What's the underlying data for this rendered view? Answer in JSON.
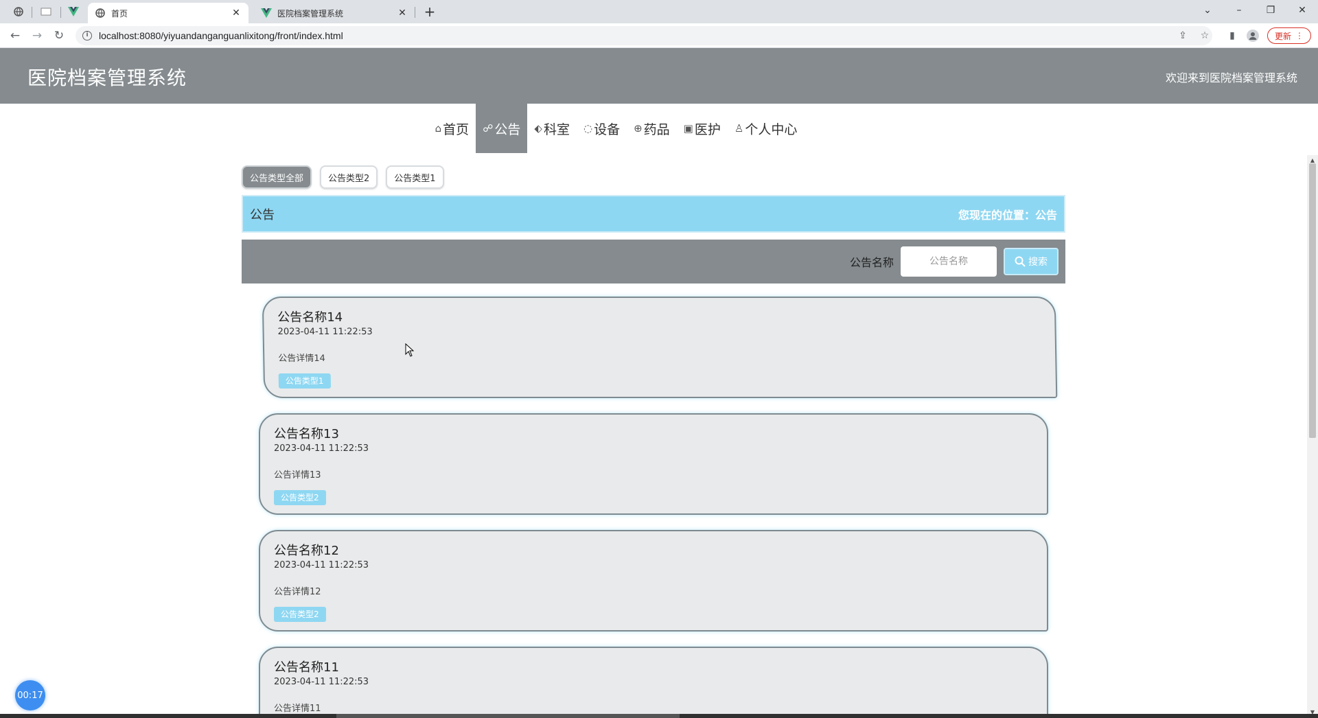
{
  "browser": {
    "tabs": [
      {
        "title": "首页",
        "active": true
      },
      {
        "title": "医院档案管理系统",
        "active": false
      }
    ],
    "url": "localhost:8080/yiyuandanganguanlixitong/front/index.html",
    "update_label": "更新"
  },
  "header": {
    "title": "医院档案管理系统",
    "welcome": "欢迎来到医院档案管理系统"
  },
  "nav": {
    "items": [
      {
        "label": "首页",
        "icon": "home-icon",
        "glyph": "⌂"
      },
      {
        "label": "公告",
        "icon": "news-icon",
        "glyph": "☍"
      },
      {
        "label": "科室",
        "icon": "tag-icon",
        "glyph": "⬖"
      },
      {
        "label": "设备",
        "icon": "circle-icon",
        "glyph": "◌"
      },
      {
        "label": "药品",
        "icon": "globe-icon",
        "glyph": "⊕"
      },
      {
        "label": "医护",
        "icon": "clipboard-icon",
        "glyph": "▣"
      },
      {
        "label": "个人中心",
        "icon": "user-icon",
        "glyph": "♙"
      }
    ],
    "active_index": 1
  },
  "filters": {
    "items": [
      "公告类型全部",
      "公告类型2",
      "公告类型1"
    ],
    "active_index": 0
  },
  "breadcrumb": {
    "title": "公告",
    "location": "您现在的位置：公告"
  },
  "search": {
    "label": "公告名称",
    "placeholder": "公告名称",
    "button_label": "搜索"
  },
  "news": [
    {
      "title": "公告名称14",
      "time": "2023-04-11 11:22:53",
      "detail": "公告详情14",
      "type": "公告类型1"
    },
    {
      "title": "公告名称13",
      "time": "2023-04-11 11:22:53",
      "detail": "公告详情13",
      "type": "公告类型2"
    },
    {
      "title": "公告名称12",
      "time": "2023-04-11 11:22:53",
      "detail": "公告详情12",
      "type": "公告类型2"
    },
    {
      "title": "公告名称11",
      "time": "2023-04-11 11:22:53",
      "detail": "公告详情11",
      "type": ""
    }
  ],
  "timer": "00:17",
  "colors": {
    "header_bg": "#858b8e",
    "accent": "#8ed7f2",
    "update": "#d93025",
    "timer": "#3d8ef0"
  }
}
